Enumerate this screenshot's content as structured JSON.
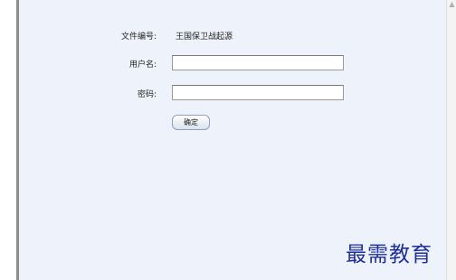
{
  "form": {
    "doc_number_label": "文件编号:",
    "doc_number_value": "王国保卫战起源",
    "username_label": "用户名:",
    "username_value": "",
    "password_label": "密码:",
    "password_value": "",
    "submit_label": "确定"
  },
  "watermark": "最需教育",
  "scrollbar": {
    "up_arrow_icon": "chevron-up-icon"
  }
}
